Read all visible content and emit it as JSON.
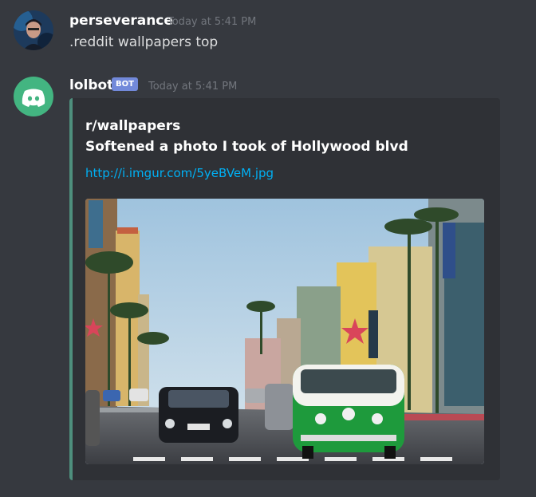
{
  "messages": [
    {
      "username": "perseverance",
      "timestamp": "Today at 5:41 PM",
      "content": ".reddit wallpapers top"
    },
    {
      "username": "lolbot",
      "bot_tag": "BOT",
      "timestamp": "Today at 5:41 PM",
      "embed": {
        "author": "r/wallpapers",
        "title": "Softened a photo I took of Hollywood blvd",
        "link": "http://i.imgur.com/5yeBVeM.jpg",
        "image_description": "Painted street scene of Hollywood Blvd with green and white VW van, black Mercedes, palm trees and Dolby Theatre"
      }
    }
  ],
  "colors": {
    "background": "#36393f",
    "embed_background": "#2f3136",
    "embed_accent": "#4e8f7d",
    "link": "#00b0f4",
    "bot_tag": "#7289da",
    "discord_avatar": "#43b581"
  },
  "icons": [
    "user-avatar",
    "discord-logo-icon"
  ]
}
